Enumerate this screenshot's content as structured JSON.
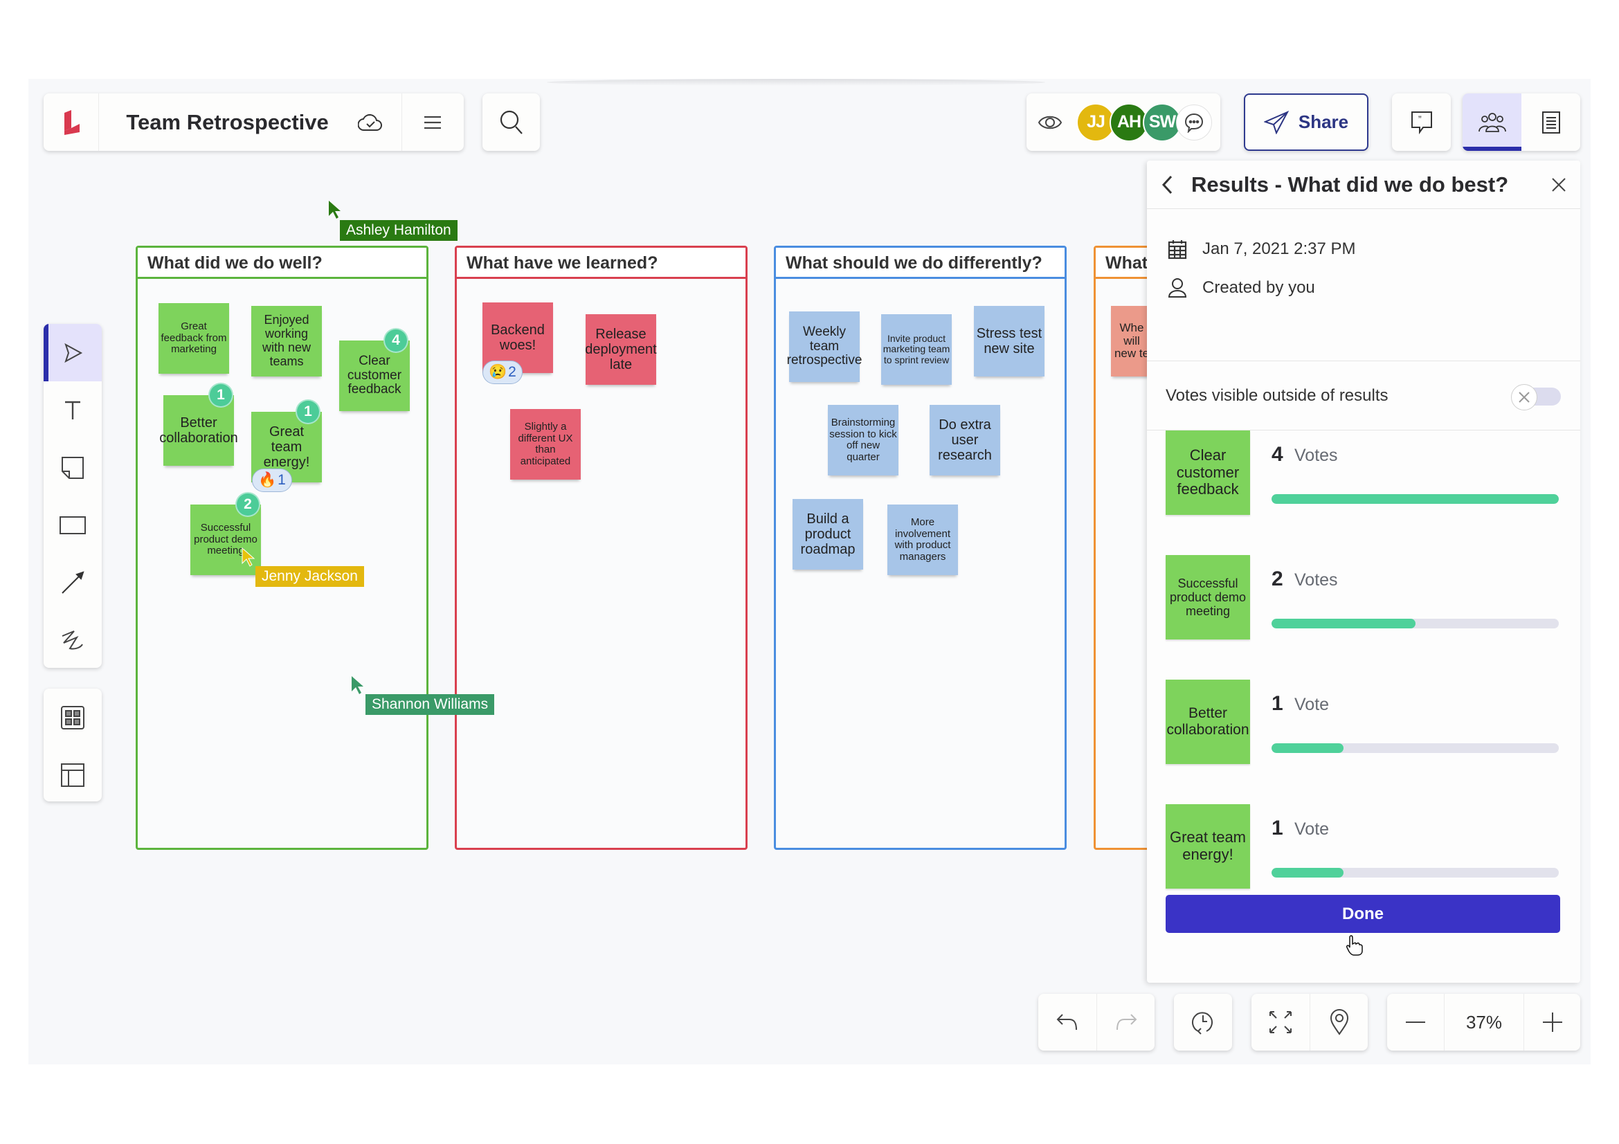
{
  "app": {
    "title": "Team Retrospective",
    "logo": "lucidspark-logo-icon",
    "accent_color": "#3a33c6"
  },
  "header": {
    "save_status_icon": "cloud-check-icon",
    "menu_icon": "hamburger-menu-icon",
    "search_icon": "search-icon",
    "view_icon": "eye-icon",
    "collaborators": [
      {
        "initials": "JJ",
        "name": "Jenny Jackson",
        "color": "#e3b80f"
      },
      {
        "initials": "AH",
        "name": "Ashley Hamilton",
        "color": "#2a7a12"
      },
      {
        "initials": "SW",
        "name": "Shannon Williams",
        "color": "#3a9a68"
      }
    ],
    "chat_icon": "chat-bubble-icon",
    "share_label": "Share",
    "comments_icon": "comment-quote-icon",
    "panels": [
      {
        "name": "collaborators-panel",
        "icon": "people-icon",
        "active": true
      },
      {
        "name": "notes-panel",
        "icon": "document-icon",
        "active": false
      }
    ]
  },
  "left_toolbar": {
    "tools": [
      {
        "name": "select",
        "icon": "pointer-icon",
        "active": true
      },
      {
        "name": "text",
        "icon": "text-icon",
        "active": false
      },
      {
        "name": "sticky-note",
        "icon": "sticky-note-icon",
        "active": false
      },
      {
        "name": "shape",
        "icon": "rectangle-icon",
        "active": false
      },
      {
        "name": "line",
        "icon": "arrow-line-icon",
        "active": false
      },
      {
        "name": "freehand",
        "icon": "freehand-draw-icon",
        "active": false
      }
    ],
    "extras": [
      {
        "name": "templates",
        "icon": "grid-icon"
      },
      {
        "name": "frame",
        "icon": "frame-layout-icon"
      }
    ]
  },
  "columns": [
    {
      "title": "What did we do well?",
      "color": "#5cb43d",
      "notes": [
        {
          "text": "Great feedback from marketing",
          "color": "green"
        },
        {
          "text": "Enjoyed working with new teams",
          "color": "green"
        },
        {
          "text": "Clear customer feedback",
          "color": "green",
          "votes": "4"
        },
        {
          "text": "Better collaboration",
          "color": "green",
          "votes": "1"
        },
        {
          "text": "Great team energy!",
          "color": "green",
          "votes": "1",
          "reaction": {
            "emoji": "🔥",
            "count": "1"
          }
        },
        {
          "text": "Successful product demo meeting",
          "color": "green",
          "votes": "2"
        }
      ]
    },
    {
      "title": "What have we learned?",
      "color": "#d9404f",
      "notes": [
        {
          "text": "Backend woes!",
          "color": "red",
          "reaction": {
            "emoji": "😢",
            "count": "2"
          }
        },
        {
          "text": "Release deployment late",
          "color": "red"
        },
        {
          "text": "Slightly a different UX than anticipated",
          "color": "red"
        }
      ]
    },
    {
      "title": "What should we do differently?",
      "color": "#4a8de0",
      "notes": [
        {
          "text": "Weekly team retrospective",
          "color": "blue"
        },
        {
          "text": "Invite product marketing team to sprint review",
          "color": "blue"
        },
        {
          "text": "Stress test new site",
          "color": "blue"
        },
        {
          "text": "Brainstorming session to kick off new quarter",
          "color": "blue"
        },
        {
          "text": "Do extra user research",
          "color": "blue"
        },
        {
          "text": "Build a product roadmap",
          "color": "blue"
        },
        {
          "text": "More involvement with product managers",
          "color": "blue"
        }
      ]
    },
    {
      "title": "What",
      "color": "#ef9234",
      "notes": [
        {
          "text": "Whe will new te",
          "color": "salmon"
        }
      ]
    }
  ],
  "cursors": [
    {
      "name": "Ashley Hamilton",
      "color": "#2a7a12"
    },
    {
      "name": "Jenny Jackson",
      "color": "#e3b80f"
    },
    {
      "name": "Shannon Williams",
      "color": "#3a9a68"
    }
  ],
  "results_panel": {
    "title": "Results - What did we do best?",
    "back_icon": "chevron-left-icon",
    "close_icon": "close-icon",
    "date": "Jan 7, 2021 2:37 PM",
    "created_by": "Created by you",
    "toggle_label": "Votes visible outside of results",
    "toggle_on": false,
    "results": [
      {
        "note": "Clear customer feedback",
        "count": "4",
        "unit": "Votes",
        "fraction": 1.0
      },
      {
        "note": "Successful product demo meeting",
        "count": "2",
        "unit": "Votes",
        "fraction": 0.5
      },
      {
        "note": "Better collaboration",
        "count": "1",
        "unit": "Vote",
        "fraction": 0.25
      },
      {
        "note": "Great team energy!",
        "count": "1",
        "unit": "Vote",
        "fraction": 0.25
      }
    ],
    "done_label": "Done"
  },
  "bottom_toolbar": {
    "undo_icon": "undo-icon",
    "redo_icon": "redo-icon",
    "history_icon": "history-icon",
    "fit_icon": "fit-screen-icon",
    "location_icon": "map-pin-icon",
    "zoom_out_icon": "minus-icon",
    "zoom_level": "37%",
    "zoom_in_icon": "plus-icon"
  }
}
